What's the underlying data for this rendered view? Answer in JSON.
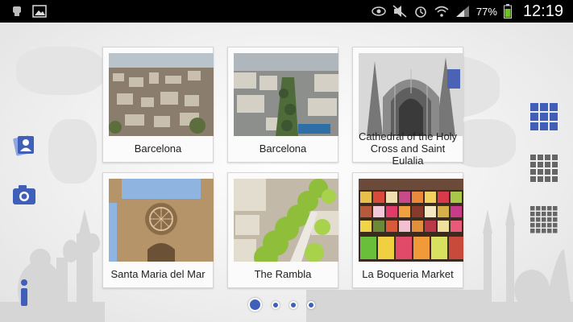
{
  "statusbar": {
    "battery_percent": "77%",
    "time": "12:19",
    "icons": [
      "usb-debug-icon",
      "gallery-icon",
      "eye-icon",
      "mute-icon",
      "alarm-icon",
      "wifi-icon",
      "signal-icon",
      "battery-icon"
    ]
  },
  "tiles": [
    {
      "caption": "Barcelona",
      "thumb": "city-aerial-1"
    },
    {
      "caption": "Barcelona",
      "thumb": "city-aerial-2"
    },
    {
      "caption": "Cathedral of the Holy Cross and Saint Eulalia",
      "thumb": "gothic-cathedral"
    },
    {
      "caption": "Santa Maria del Mar",
      "thumb": "rose-window-church"
    },
    {
      "caption": "The Rambla",
      "thumb": "tree-lined-boulevard"
    },
    {
      "caption": "La Boqueria Market",
      "thumb": "market-stall"
    }
  ],
  "sidebar_left": {
    "icons": [
      "contact-card-icon",
      "camera-icon",
      "info-icon"
    ]
  },
  "sidebar_right": {
    "icons": [
      "grid-3x3-icon",
      "grid-4x4-icon",
      "grid-5x5-icon"
    ]
  },
  "pagination": {
    "pages": 4,
    "current": 1
  },
  "colors": {
    "accent": "#3f5fb8",
    "statusbar": "#000000",
    "tile_bg": "#fbfbfb"
  }
}
